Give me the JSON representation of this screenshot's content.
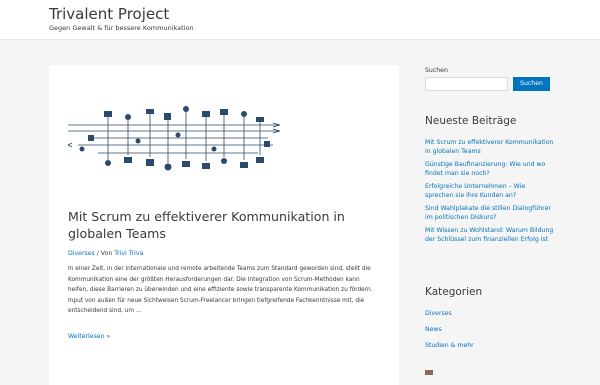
{
  "header": {
    "site_title": "Trivalent Project",
    "site_description": "Gegen Gewalt & für bessere Kommunikation"
  },
  "post": {
    "image_name": "team-communication-illustration",
    "title": "Mit Scrum zu effektiverer Kommunikation in globalen Teams",
    "category": "Diverses",
    "meta_separator": " / Von ",
    "author": "Trivi Triva",
    "excerpt": "In einer Zeit, in der internationale und remote arbeitende Teams zum Standard geworden sind, stellt die Kommunikation eine der größten Herausforderungen dar. Die Integration von Scrum-Methoden kann helfen, diese Barrieren zu überwinden und eine effiziente sowie transparente Kommunikation zu fördern. Input von außen für neue Sichtweisen Scrum-Freelancer bringen tiefgreifende Fachkenntnisse mit, die entscheidend sind, um …",
    "read_more": "Weiterlesen »"
  },
  "sidebar": {
    "search": {
      "label": "Suchen",
      "placeholder": "",
      "button_label": "Suchen"
    },
    "recent": {
      "heading": "Neueste Beiträge",
      "items": [
        "Mit Scrum zu effektiverer Kommunikation in globalen Teams",
        "Günstige Baufinanzierung: Wie und wo findet man sie noch?",
        "Erfolgreiche Unternehmen – Wie sprechen sie ihre Kunden an?",
        "Sind Wahlplakate die stillen Dialogführer im politischen Diskurs?",
        "Mit Wissen zu Wohlstand: Warum Bildung der Schlüssel zum finanziellen Erfolg ist"
      ]
    },
    "categories": {
      "heading": "Kategorien",
      "items": [
        "Diverses",
        "News",
        "Studien & mehr"
      ]
    }
  },
  "colors": {
    "accent": "#0274be",
    "text": "#3a3a3a",
    "background": "#f5f5f5",
    "illustration": "#2c4a6b"
  }
}
